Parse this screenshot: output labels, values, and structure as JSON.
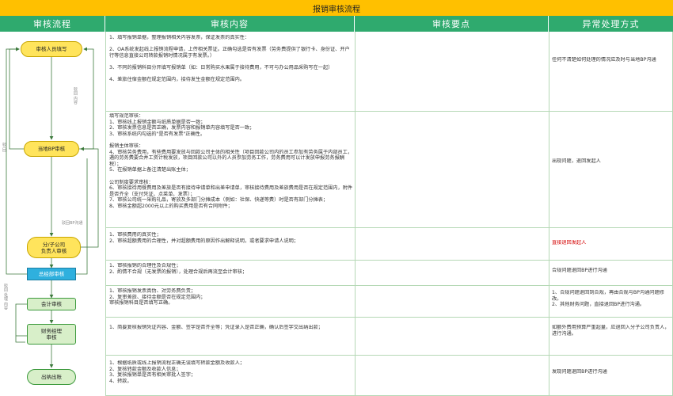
{
  "title": "报销审核流程",
  "headers": [
    "审核流程",
    "审核内容",
    "审核要点",
    "异常处理方式"
  ],
  "flow": {
    "nodes": [
      {
        "label": "审核人员填写"
      },
      {
        "label": "当地BP审核"
      },
      {
        "label": "分/子公司\n负责人审核"
      },
      {
        "label": "总经部审核"
      },
      {
        "label": "会计审核"
      },
      {
        "label": "财务经理\n审核"
      },
      {
        "label": "出纳出账"
      }
    ],
    "side_labels": [
      "驳回 内容",
      "驳 回",
      "驳回BP沟通",
      "驳回 处理 内容"
    ]
  },
  "rows": [
    {
      "content": "1、填写报销单据，整理报销相关内容发票，保证发票的真实性：\n\n2、OA系统发起线上报销流程申请，上传相关票证。正确勾选是否有发票（劳务费提供了银行卡、身份证、开户行等信息直接公司转款报销时情况属于有发票。）\n\n3、不同的报销科目分开填写报销单（如：日常购买水果属于接待费用，不可与办公用品采购写在一起）\n\n4、差旅住宿金额在规定范围内，接待发生金额在规定范围内。",
      "exception": "任何不清楚如何处理的情况应及时与当地BP沟通",
      "red": false
    },
    {
      "content": "填写规范审核：\n1、审核线上报销金额与纸质单据是否一致；\n2、审核发票信息是否正确，发票内容和报销单内容填写是否一致；\n3、审核系统内勾选的\"是否有发票\"正确性。\n\n报销主体审核：\n4、审核劳务费用，有些费用要发放与回款公司主体的相关性（项目回款公司内的员工参加有劳务属于内部员工，遇的劳务费要合并工资计税发放，项目回款公司以外的人员参加劳务工作，劳务费用可以计发放申报劳务报酬税）；\n5、在报销单据上备注清楚出账主体；\n\n公司制度要求审核：\n6、审核接待用餐费用及差旅是否有接待申请单和出差申请单，审核接待费用及差旅费用是否在规定范围内，附件是否齐全（支付凭证、点菜单、发票）；\n7、审核公司统一采购礼品，寄放及多部门分摊成本（例如：社保、快递等费）时是否有部门分摊表；\n8、审核金额超2000元以上的购买费用是否有合同附件；",
      "exception": "出现问题，退回发起人",
      "red": false
    },
    {
      "content": "1、审核费用的真实性；\n2、审核超额费用的合理性，并对超额费用的原因作出解释说明，或者要求申请人说明；",
      "exception": "直接退回发起人",
      "red": true
    },
    {
      "content": "1、审核报销的合理性及合规性；\n2、酌情不合规（无发票的报销），处理合规后再流至会计审核；",
      "exception": "合规问题退回BP进行沟通",
      "red": false
    },
    {
      "content": "1、审核报销发票真伪、对劳务费负责；\n2、复审差旅、接待金额是否在规定范围内；\n审核报销科目是否填写正确。",
      "exception": "1、合规问题退回到合规，再由合规与BP沟通问题修改。\n2、其他财务问题，直接退回BP进行沟通。",
      "red": false
    },
    {
      "content": "1、简要复核报销凭证内容、金额、签字是否齐全等；凭证录入是否正确，确认后签字交出纳出款；",
      "exception": "如额外费用预算严重超量，应退回入分子公司负责人，进行沟通。",
      "red": false
    },
    {
      "content": "1、根据纸质或线上报销流程正确无误填写转款金额及收款人；\n2、复核转款金额及收款人信息；\n3、复核报销单是否有相关审批人签字；\n4、转款。",
      "exception": "发现问题退回BP进行沟通",
      "red": false
    }
  ]
}
